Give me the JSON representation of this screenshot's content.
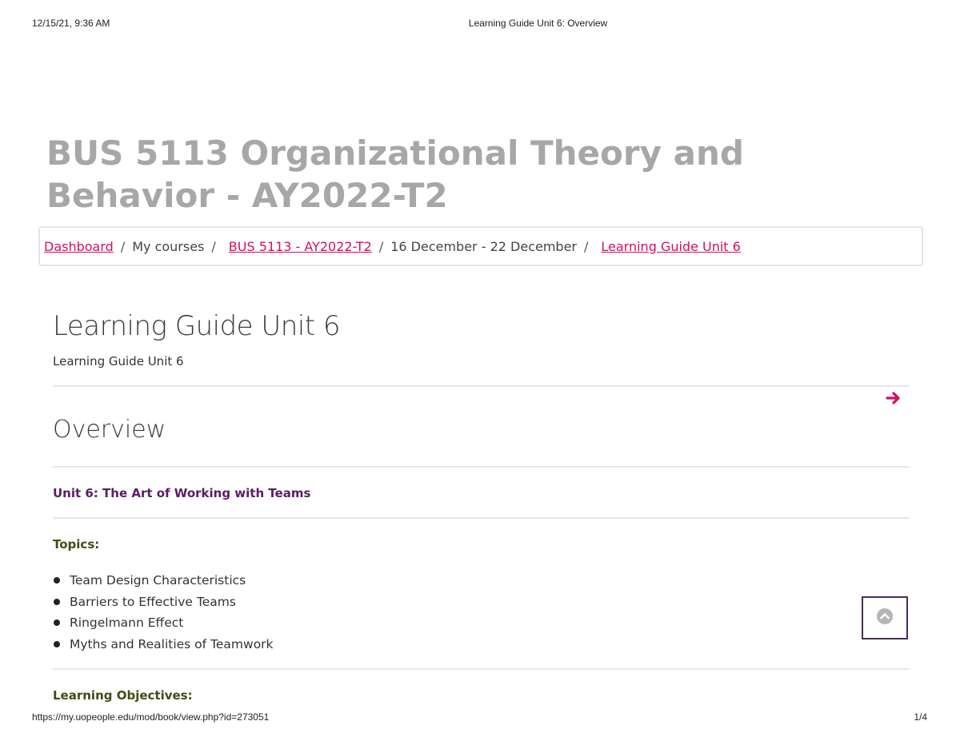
{
  "print_header": {
    "timestamp": "12/15/21, 9:36 AM",
    "page_title": "Learning Guide Unit 6: Overview"
  },
  "course_title": "BUS 5113 Organizational Theory and Behavior - AY2022-T2",
  "breadcrumb": {
    "items": [
      {
        "label": "Dashboard",
        "link": true
      },
      {
        "label": "My courses",
        "link": false
      },
      {
        "label": "BUS 5113 - AY2022-T2",
        "link": true
      },
      {
        "label": "16 December - 22 December",
        "link": false
      },
      {
        "label": "Learning Guide Unit 6",
        "link": true
      }
    ],
    "separator": "/"
  },
  "page": {
    "heading": "Learning Guide Unit 6",
    "subheading": "Learning Guide Unit 6",
    "section_heading": "Overview",
    "unit_title": "Unit 6: The Art of Working with Teams",
    "topics_label": "Topics:",
    "topics": [
      "Team Design Characteristics",
      "Barriers to Effective Teams",
      "Ringelmann Effect",
      "Myths and Realities of Teamwork"
    ],
    "objectives_label": "Learning Objectives:"
  },
  "icons": {
    "next": "arrow-right-icon",
    "scroll_top": "chevron-up-circle-icon"
  },
  "colors": {
    "link": "#d10f64",
    "unit_title": "#5e1a68",
    "label_green": "#3f4d16",
    "course_title": "#a7a7a7"
  },
  "print_footer": {
    "url": "https://my.uopeople.edu/mod/book/view.php?id=273051",
    "page": "1/4"
  }
}
